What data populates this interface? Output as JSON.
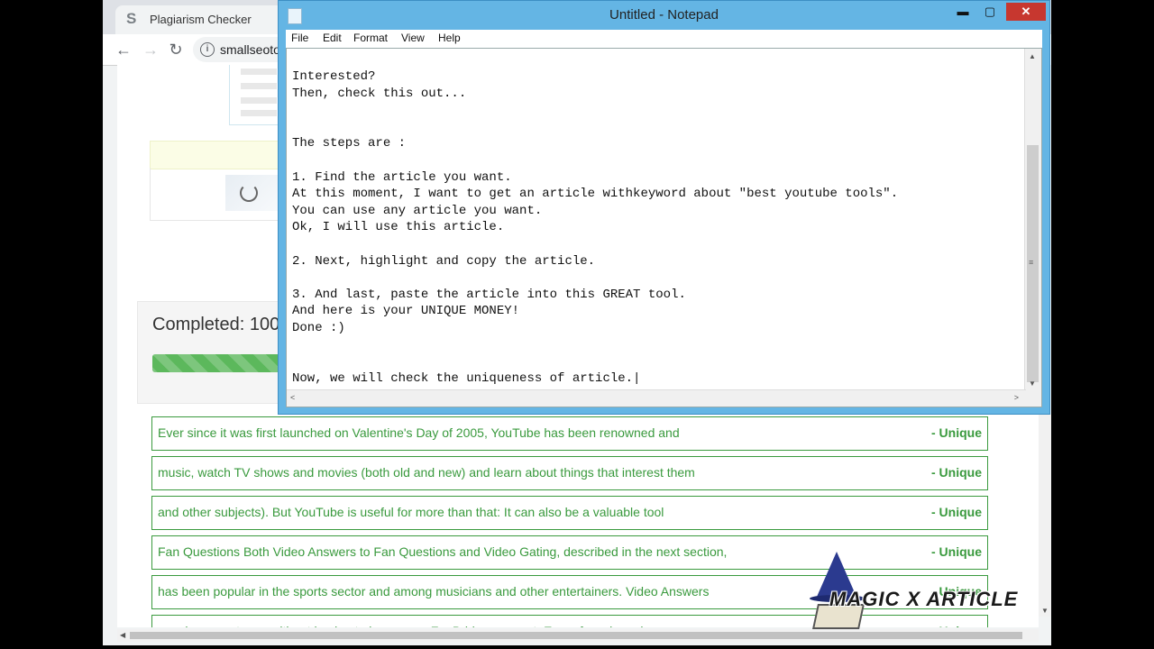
{
  "browser": {
    "tab_title": "Plagiarism Checker",
    "tab_icon": "smallseotools-logo-icon",
    "url": "smallseoto",
    "back_icon": "←",
    "forward_icon": "→",
    "reload_icon": "↻",
    "info_icon": "i"
  },
  "page": {
    "completed_text": "Completed: 100",
    "progress_percent": 100,
    "results": [
      {
        "text": "Ever since it was first launched on Valentine's Day of 2005, YouTube has been renowned and",
        "status": "- Unique"
      },
      {
        "text": "music, watch TV shows and movies (both old and new) and learn about things that interest them",
        "status": "- Unique"
      },
      {
        "text": "and other subjects). But YouTube is useful for more than that: It can also be a valuable tool",
        "status": "- Unique"
      },
      {
        "text": "Fan Questions Both Video Answers to Fan Questions and Video Gating, described in the next section,",
        "status": "- Unique"
      },
      {
        "text": "has been popular in the sports sector and among musicians and other entertainers. Video Answers",
        "status": "- Unique"
      },
      {
        "text": "may have sent you, without having to leave your FanBridge account. Every fan who asks you a",
        "status": "Unique"
      }
    ],
    "colors": {
      "result_green": "#3a9a3e",
      "progress_green": "#5cb85c"
    }
  },
  "notepad": {
    "title": "Untitled - Notepad",
    "menu": [
      "File",
      "Edit",
      "Format",
      "View",
      "Help"
    ],
    "controls": {
      "minimize": "▬",
      "maximize": "▢",
      "close": "✕"
    },
    "text": "Interested?\nThen, check this out...\n\n\nThe steps are :\n\n1. Find the article you want.\nAt this moment, I want to get an article withkeyword about \"best youtube tools\".\nYou can use any article you want.\nOk, I will use this article.\n\n2. Next, highlight and copy the article.\n\n3. And last, paste the article into this GREAT tool.\nAnd here is your UNIQUE MONEY!\nDone :)\n\n\nNow, we will check the uniqueness of article.|",
    "colors": {
      "title_bar": "#64b5e4",
      "close_button": "#c7372f"
    }
  },
  "watermark": {
    "text": "MAGIC X ARTICLE",
    "icon": "wizard-hat-book-icon"
  }
}
